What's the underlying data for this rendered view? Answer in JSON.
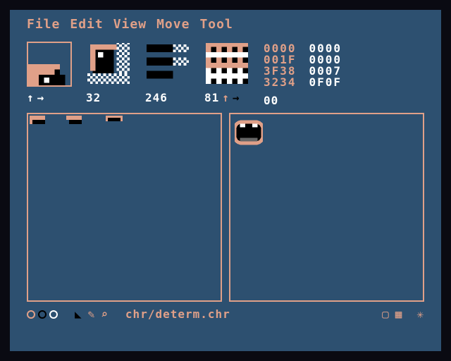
{
  "menu": {
    "items": [
      "File",
      "Edit",
      "View",
      "Move",
      "Tool"
    ]
  },
  "toolbar": {
    "slot1": {
      "label": "↑→"
    },
    "slot2": {
      "label": "32"
    },
    "slot3": {
      "label": "246"
    },
    "slot4": {
      "label": "81",
      "suffix": "↑→"
    },
    "slot5": {
      "label": "00"
    }
  },
  "hex": {
    "left": [
      "0000",
      "001F",
      "3F38",
      "3234"
    ],
    "right": [
      "0000",
      "0000",
      "0007",
      "0F0F"
    ]
  },
  "status": {
    "filepath": "chr/determ.chr"
  },
  "colors": {
    "bg": "#2d5070",
    "accent": "#e0a088",
    "white": "#ffffff",
    "black": "#000000"
  }
}
